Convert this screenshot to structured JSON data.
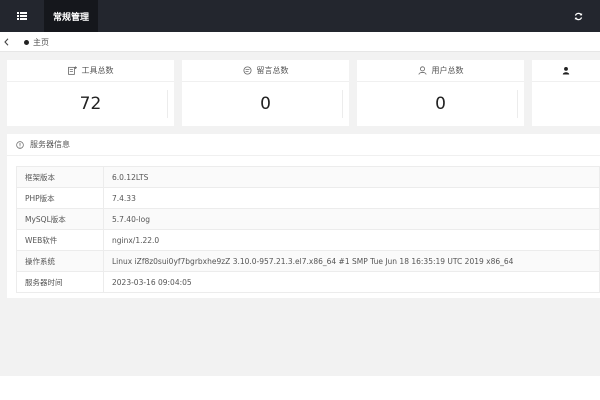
{
  "header": {
    "nav_tab": "常规管理",
    "menu_icon": "menu-icon",
    "refresh_icon": "refresh-icon"
  },
  "tabs": {
    "home": "主页"
  },
  "stats": [
    {
      "label": "工具总数",
      "value": "72",
      "icon": "tools-icon"
    },
    {
      "label": "留言总数",
      "value": "0",
      "icon": "message-icon"
    },
    {
      "label": "用户总数",
      "value": "0",
      "icon": "user-icon"
    }
  ],
  "server": {
    "title": "服务器信息",
    "rows": [
      {
        "key": "框架版本",
        "value": "6.0.12LTS"
      },
      {
        "key": "PHP版本",
        "value": "7.4.33"
      },
      {
        "key": "MySQL版本",
        "value": "5.7.40-log"
      },
      {
        "key": "WEB软件",
        "value": "nginx/1.22.0"
      },
      {
        "key": "操作系统",
        "value": "Linux iZf8z0sui0yf7bgrbxhe9zZ 3.10.0-957.21.3.el7.x86_64 #1 SMP Tue Jun 18 16:35:19 UTC 2019 x86_64"
      },
      {
        "key": "服务器时间",
        "value": "2023-03-16 09:04:05"
      }
    ]
  },
  "colors": {
    "topbar": "#23262e",
    "active_tab": "#15171c",
    "background": "#f2f2f2"
  }
}
